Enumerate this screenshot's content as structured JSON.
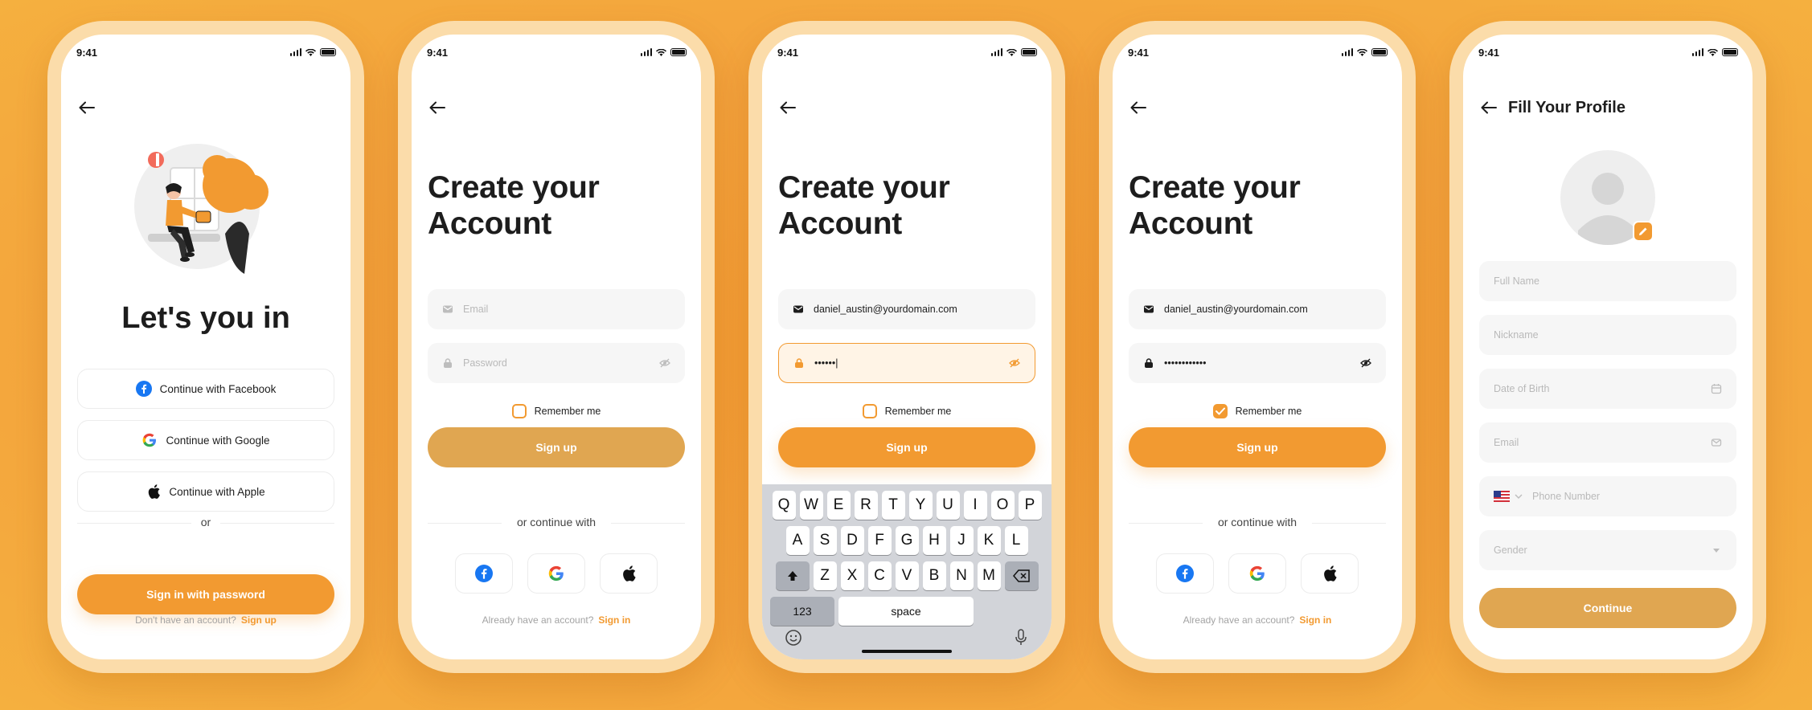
{
  "status_time": "9:41",
  "screen1": {
    "title": "Let's you in",
    "facebook_label": "Continue with Facebook",
    "google_label": "Continue with Google",
    "apple_label": "Continue with Apple",
    "divider": "or",
    "signin_password": "Sign in with password",
    "footer_text": "Don't have an account?",
    "footer_link": "Sign up"
  },
  "screen2": {
    "title": "Create your Account",
    "email_placeholder": "Email",
    "password_placeholder": "Password",
    "remember": "Remember me",
    "signup": "Sign up",
    "divider": "or continue with",
    "footer_text": "Already have an account?",
    "footer_link": "Sign in"
  },
  "screen3": {
    "title": "Create your Account",
    "email_value": "daniel_austin@yourdomain.com",
    "password_value": "••••••|",
    "remember": "Remember me",
    "signup": "Sign up",
    "keyboard_row1": [
      "Q",
      "W",
      "E",
      "R",
      "T",
      "Y",
      "U",
      "I",
      "O",
      "P"
    ],
    "keyboard_row2": [
      "A",
      "S",
      "D",
      "F",
      "G",
      "H",
      "J",
      "K",
      "L"
    ],
    "keyboard_row3": [
      "Z",
      "X",
      "C",
      "V",
      "B",
      "N",
      "M"
    ],
    "key_numbers": "123",
    "key_space": "space"
  },
  "screen4": {
    "title": "Create your Account",
    "email_value": "daniel_austin@yourdomain.com",
    "password_value": "••••••••••••",
    "remember": "Remember me",
    "remember_checked": true,
    "signup": "Sign up",
    "divider": "or continue with",
    "footer_text": "Already have an account?",
    "footer_link": "Sign in"
  },
  "screen5": {
    "title": "Fill Your Profile",
    "full_name_placeholder": "Full Name",
    "nickname_placeholder": "Nickname",
    "dob_placeholder": "Date of Birth",
    "email_placeholder": "Email",
    "phone_placeholder": "Phone Number",
    "gender_placeholder": "Gender",
    "continue": "Continue"
  },
  "colors": {
    "accent": "#f29a31",
    "accent_disabled": "#e0a651",
    "frame": "#fbdcaa",
    "background": "#f3a23c"
  }
}
